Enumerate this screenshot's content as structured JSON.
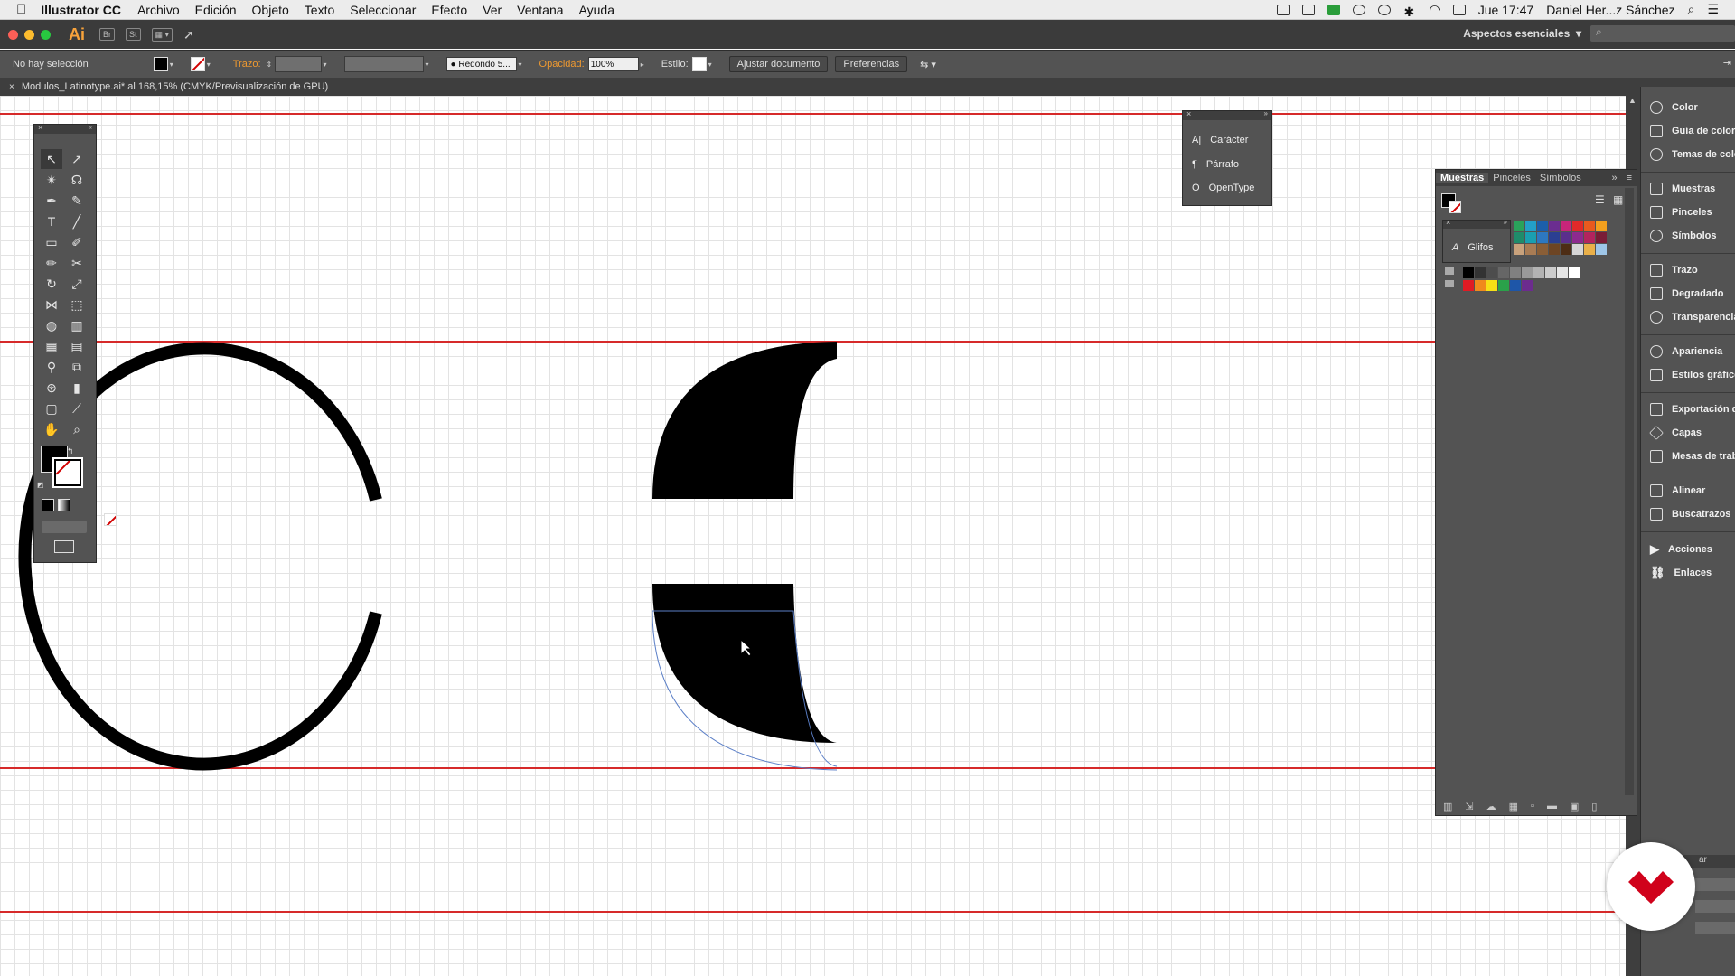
{
  "menubar": {
    "app_name": "Illustrator CC",
    "items": [
      "Archivo",
      "Edición",
      "Objeto",
      "Texto",
      "Seleccionar",
      "Efecto",
      "Ver",
      "Ventana",
      "Ayuda"
    ],
    "clock": "Jue 17:47",
    "user": "Daniel Her...z Sánchez"
  },
  "appbar": {
    "logo": "Ai",
    "bridge": "Br",
    "stock": "St",
    "workspace": "Aspectos esenciales"
  },
  "control": {
    "selection_label": "No hay selección",
    "stroke_label": "Trazo:",
    "brush": "Redondo 5...",
    "opacity_label": "Opacidad:",
    "opacity_value": "100%",
    "style_label": "Estilo:",
    "fit_button": "Ajustar documento",
    "prefs_button": "Preferencias"
  },
  "document": {
    "tab_title": "Modulos_Latinotype.ai* al 168,15% (CMYK/Previsualización de GPU)"
  },
  "char_panel": {
    "items": [
      "Carácter",
      "Párrafo",
      "OpenType"
    ]
  },
  "swatch_panel": {
    "tabs": [
      "Muestras",
      "Pinceles",
      "Símbolos"
    ]
  },
  "glyph_panel": {
    "label": "Glifos"
  },
  "dock": {
    "items": [
      "Color",
      "Guía de color",
      "Temas de colo",
      "Muestras",
      "Pinceles",
      "Símbolos",
      "Trazo",
      "Degradado",
      "Transparencia",
      "Apariencia",
      "Estilos gráficos",
      "Exportación d...",
      "Capas",
      "Mesas de trab...",
      "Alinear",
      "Buscatrazos",
      "Acciones",
      "Enlaces"
    ],
    "partial_label": "ar"
  },
  "colors": {
    "accent": "#f09a30",
    "guide": "#d62a2a",
    "badge": "#d0021b"
  }
}
